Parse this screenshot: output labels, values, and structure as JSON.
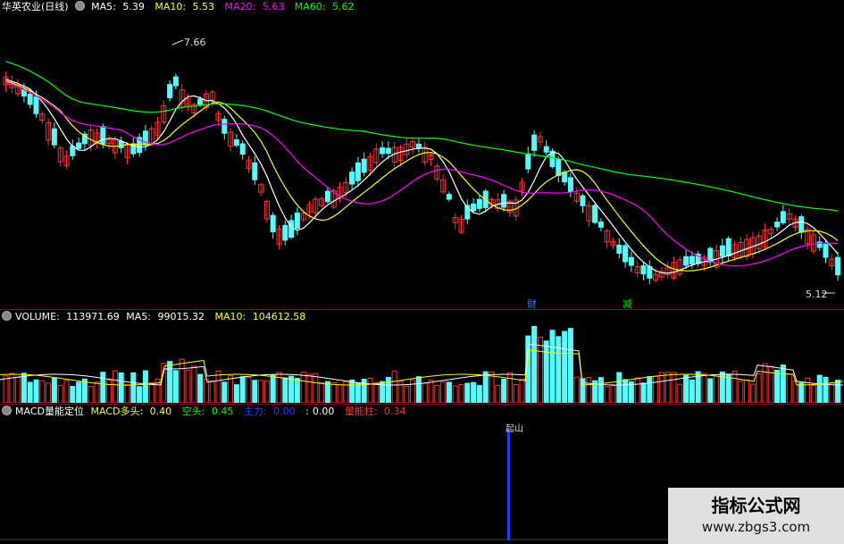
{
  "colors": {
    "up": "#ff3232",
    "down": "#54fcfc",
    "ma5": "#ffffff",
    "ma10": "#ffff00",
    "ma20": "#ff00ff",
    "ma60": "#00ff00",
    "panel_sep": "#7a1010",
    "macd_bar": "#1e3cff"
  },
  "price_panel": {
    "stock_name": "华英农业(日线)",
    "ma5": {
      "label": "MA5:",
      "value": "5.39"
    },
    "ma10": {
      "label": "MA10:",
      "value": "5.53"
    },
    "ma20": {
      "label": "MA20:",
      "value": "5.63"
    },
    "ma60": {
      "label": "MA60:",
      "value": "5.62"
    },
    "high_label": "7.66",
    "low_label": "5.12",
    "marker_cai": "财",
    "marker_jian": "减"
  },
  "volume_panel": {
    "title": "VOLUME:",
    "volume_value": "113971.69",
    "ma5": {
      "label": "MA5:",
      "value": "99015.32"
    },
    "ma10": {
      "label": "MA10:",
      "value": "104612.58"
    }
  },
  "macd_panel": {
    "title": "MACD量能定位",
    "duotou": {
      "label": "MACD多头:",
      "value": "0.40"
    },
    "kongtou": {
      "label": "空头:",
      "value": "0.45"
    },
    "zhuli": {
      "label": "主力:",
      "value": "0.00"
    },
    "zero": {
      "label": ":",
      "value": "0.00"
    },
    "liangneng": {
      "label": "量能柱:",
      "value": "0.34"
    },
    "signal_label": "起山"
  },
  "watermark": {
    "title": "指标公式网",
    "url": "www.zbgs3.com"
  }
}
